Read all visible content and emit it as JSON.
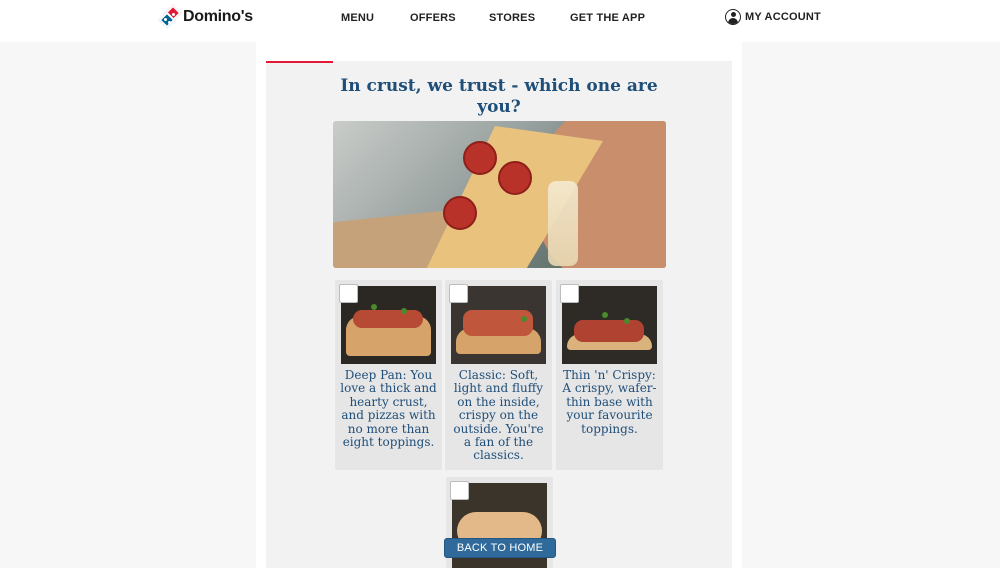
{
  "header": {
    "brand": "Domino's",
    "nav": [
      {
        "label": "MENU"
      },
      {
        "label": "OFFERS"
      },
      {
        "label": "STORES"
      },
      {
        "label": "GET THE APP"
      }
    ],
    "account_label": "MY ACCOUNT"
  },
  "quiz": {
    "title": "In crust, we trust - which one are you?",
    "options": [
      {
        "description": "Deep Pan: You love a thick and hearty crust, and pizzas with no more than eight toppings.",
        "checked": false
      },
      {
        "description": "Classic: Soft, light and fluffy on the inside, crispy on the outside. You're a fan of the classics.",
        "checked": false
      },
      {
        "description": "Thin 'n' Crispy: A crispy, wafer-thin base with your favourite toppings.",
        "checked": false
      },
      {
        "description": "",
        "checked": false
      }
    ],
    "back_button": "BACK TO HOME"
  },
  "colors": {
    "brand_red": "#e31837",
    "brand_blue": "#006491",
    "title_blue": "#1f4e79",
    "button_blue": "#2f6a9b"
  },
  "icons": [
    "dominos-logo-icon",
    "account-icon",
    "checkbox-icon"
  ]
}
